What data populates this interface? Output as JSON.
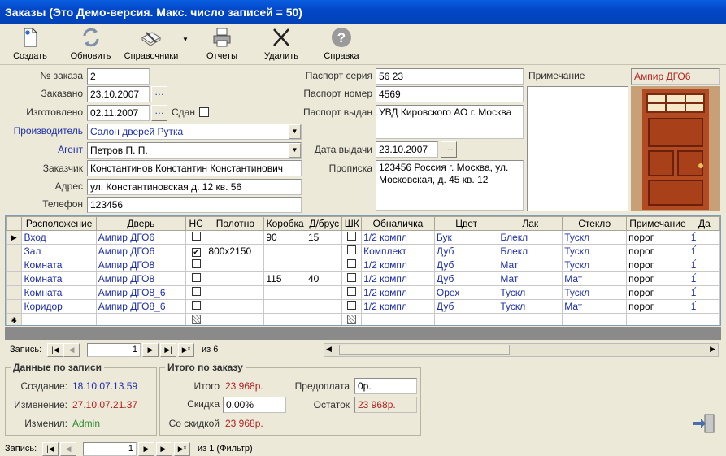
{
  "window": {
    "title": "Заказы  (Это Демо-версия. Макс. число записей = 50)"
  },
  "toolbar": {
    "create": "Создать",
    "update": "Обновить",
    "references": "Справочники",
    "reports": "Отчеты",
    "delete": "Удалить",
    "help": "Справка"
  },
  "form": {
    "order_no_label": "№ заказа",
    "order_no": "2",
    "ordered_label": "Заказано",
    "ordered": "23.10.2007",
    "made_label": "Изготовлено",
    "made": "02.11.2007",
    "delivered_label": "Сдан",
    "maker_label": "Производитель",
    "maker": "Салон дверей Рутка",
    "agent_label": "Агент",
    "agent": "Петров П. П.",
    "customer_label": "Заказчик",
    "customer": "Константинов Константин Константинович",
    "address_label": "Адрес",
    "address": "ул. Константиновская д. 12 кв. 56",
    "phone_label": "Телефон",
    "phone": "123456",
    "passport_series_label": "Паспорт серия",
    "passport_series": "56 23",
    "passport_number_label": "Паспорт номер",
    "passport_number": "4569",
    "passport_issued_label": "Паспорт выдан",
    "passport_issued": "УВД Кировского АО г. Москва",
    "issue_date_label": "Дата выдачи",
    "issue_date": "23.10.2007",
    "registration_label": "Прописка",
    "registration": "123456 Россия г. Москва, ул. Московская, д. 45 кв. 12",
    "note_label": "Примечание",
    "note": "",
    "door_name": "Ампир ДГО6"
  },
  "grid": {
    "columns": [
      "Расположение",
      "Дверь",
      "НС",
      "Полотно",
      "Коробка",
      "Д/брус",
      "ШК",
      "Обналичка",
      "Цвет",
      "Лак",
      "Стекло",
      "Примечание",
      "Да"
    ],
    "rows": [
      {
        "loc": "Вход",
        "door": "Ампир ДГО6",
        "ns": false,
        "canvas": "",
        "box": "90",
        "brus": "15",
        "shk": false,
        "trim": "1/2 компл",
        "color": "Бук",
        "lak": "Блекл",
        "glass": "Тускл",
        "note": "порог",
        "da": "1́"
      },
      {
        "loc": "Зал",
        "door": "Ампир ДГО6",
        "ns": true,
        "canvas": "800x2150",
        "box": "",
        "brus": "",
        "shk": false,
        "trim": "Комплект",
        "color": "Дуб",
        "lak": "Блекл",
        "glass": "Тускл",
        "note": "порог",
        "da": "1́"
      },
      {
        "loc": "Комната",
        "door": "Ампир ДГО8",
        "ns": false,
        "canvas": "",
        "box": "",
        "brus": "",
        "shk": false,
        "trim": "1/2 компл",
        "color": "Дуб",
        "lak": "Мат",
        "glass": "Тускл",
        "note": "порог",
        "da": "1́"
      },
      {
        "loc": "Комната",
        "door": "Ампир ДГО8",
        "ns": false,
        "canvas": "",
        "box": "115",
        "brus": "40",
        "shk": false,
        "trim": "1/2 компл",
        "color": "Дуб",
        "lak": "Мат",
        "glass": "Мат",
        "note": "порог",
        "da": "1́"
      },
      {
        "loc": "Комната",
        "door": "Ампир ДГО8_6",
        "ns": false,
        "canvas": "",
        "box": "",
        "brus": "",
        "shk": false,
        "trim": "1/2 компл",
        "color": "Орех",
        "lak": "Тускл",
        "glass": "Тускл",
        "note": "порог",
        "da": "1́"
      },
      {
        "loc": "Коридор",
        "door": "Ампир ДГО8_6",
        "ns": false,
        "canvas": "",
        "box": "",
        "brus": "",
        "shk": false,
        "trim": "1/2 компл",
        "color": "Дуб",
        "lak": "Тускл",
        "glass": "Мат",
        "note": "порог",
        "da": "1́"
      }
    ],
    "nav_label": "Запись:",
    "nav_current": "1",
    "nav_of": "из 6"
  },
  "record_info": {
    "title": "Данные по записи",
    "created_label": "Создание:",
    "created": "18.10.07.13.59",
    "changed_label": "Изменение:",
    "changed": "27.10.07.21.37",
    "changed_by_label": "Изменил:",
    "changed_by": "Admin"
  },
  "totals": {
    "title": "Итого по заказу",
    "total_label": "Итого",
    "total": "23 968р.",
    "discount_label": "Скидка",
    "discount": "0,00%",
    "with_discount_label": "Со скидкой",
    "with_discount": "23 968р.",
    "prepay_label": "Предоплата",
    "prepay": "0р.",
    "rest_label": "Остаток",
    "rest": "23 968р."
  },
  "bottom_nav": {
    "label": "Запись:",
    "current": "1",
    "of": "из  1 (Фильтр)"
  },
  "colors": {
    "title_bar": "#0247c8",
    "link_blue": "#1d2fa8",
    "red": "#b22222",
    "green": "#2e8b2e"
  }
}
